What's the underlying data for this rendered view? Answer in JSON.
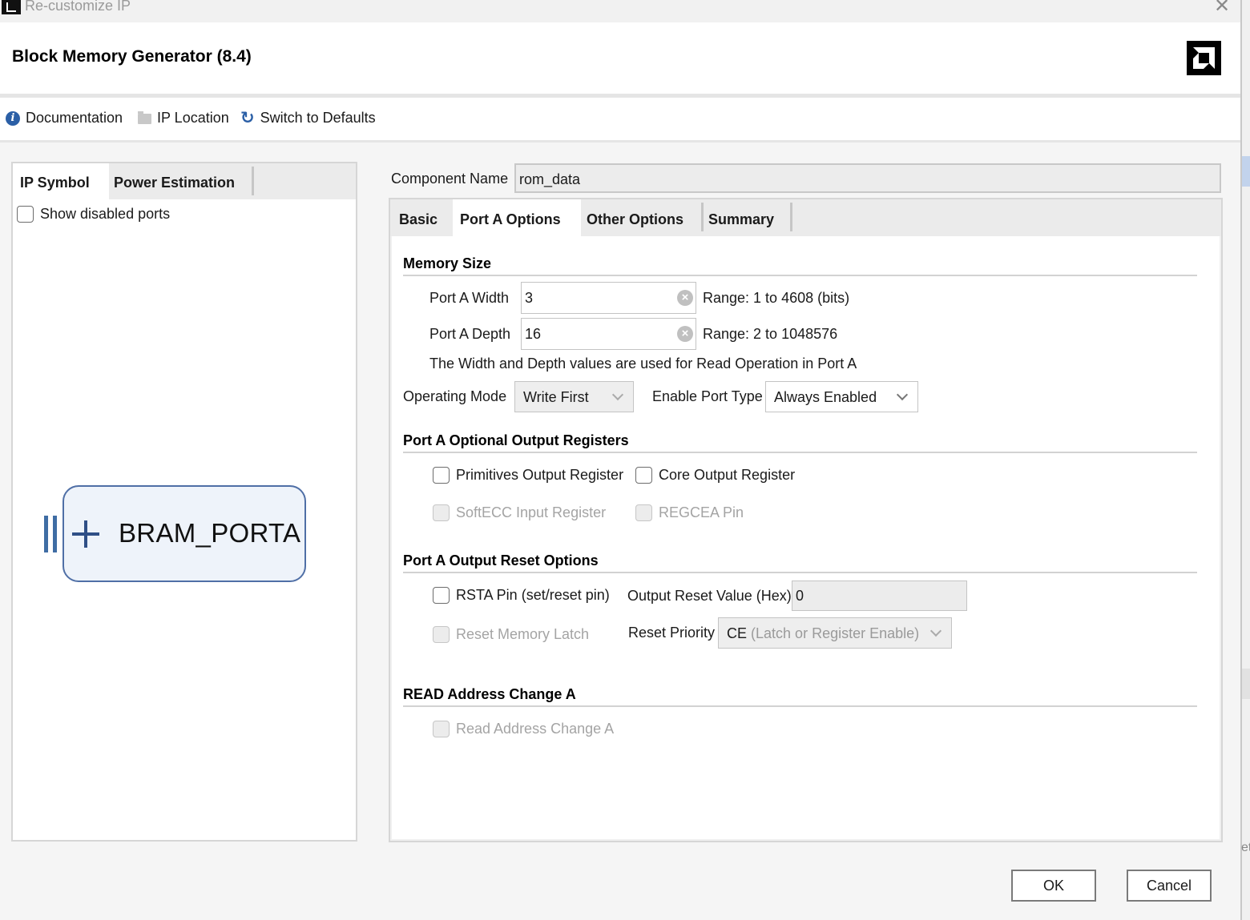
{
  "window": {
    "title": "Re-customize IP",
    "close_icon": "close-icon"
  },
  "header": {
    "title": "Block Memory Generator (8.4)",
    "logo": "brand-logo"
  },
  "toolbar": {
    "documentation": "Documentation",
    "ip_location": "IP Location",
    "switch_to_defaults": "Switch to Defaults"
  },
  "left_panel": {
    "tabs": [
      {
        "label": "IP Symbol",
        "active": true
      },
      {
        "label": "Power Estimation",
        "active": false
      }
    ],
    "show_disabled_ports": {
      "label": "Show disabled ports",
      "checked": false
    },
    "symbol": {
      "port_label": "BRAM_PORTA",
      "expand_icon": "plus-icon"
    }
  },
  "component": {
    "label": "Component Name",
    "value": "rom_data"
  },
  "right_panel": {
    "tabs": [
      {
        "label": "Basic",
        "active": false
      },
      {
        "label": "Port A Options",
        "active": true
      },
      {
        "label": "Other Options",
        "active": false
      },
      {
        "label": "Summary",
        "active": false
      }
    ],
    "memory_size": {
      "title": "Memory Size",
      "width_label": "Port A Width",
      "width_value": "3",
      "width_range": "Range: 1 to 4608 (bits)",
      "depth_label": "Port A Depth",
      "depth_value": "16",
      "depth_range": "Range: 2 to 1048576",
      "note": "The Width and Depth values are used for Read Operation in Port A",
      "operating_mode_label": "Operating Mode",
      "operating_mode_value": "Write First",
      "enable_port_type_label": "Enable Port Type",
      "enable_port_type_value": "Always Enabled"
    },
    "optional_output_registers": {
      "title": "Port A Optional Output Registers",
      "primitives_output_register": {
        "label": "Primitives Output Register",
        "checked": false,
        "enabled": true
      },
      "core_output_register": {
        "label": "Core Output Register",
        "checked": false,
        "enabled": true
      },
      "softecc_input_register": {
        "label": "SoftECC Input Register",
        "checked": false,
        "enabled": false
      },
      "regcea_pin": {
        "label": "REGCEA Pin",
        "checked": false,
        "enabled": false
      }
    },
    "output_reset_options": {
      "title": "Port A Output Reset Options",
      "rsta_pin": {
        "label": "RSTA Pin (set/reset pin)",
        "checked": false,
        "enabled": true
      },
      "output_reset_value_label": "Output Reset Value (Hex)",
      "output_reset_value": "0",
      "reset_memory_latch": {
        "label": "Reset Memory Latch",
        "checked": false,
        "enabled": false
      },
      "reset_priority_label": "Reset Priority",
      "reset_priority_value_prefix": "CE",
      "reset_priority_value_suffix": "(Latch or Register Enable)"
    },
    "read_address_change": {
      "title": "READ Address Change A",
      "read_address_change_a": {
        "label": "Read Address Change A",
        "checked": false,
        "enabled": false
      }
    }
  },
  "footer": {
    "ok": "OK",
    "cancel": "Cancel"
  },
  "background_edge_text": "et"
}
